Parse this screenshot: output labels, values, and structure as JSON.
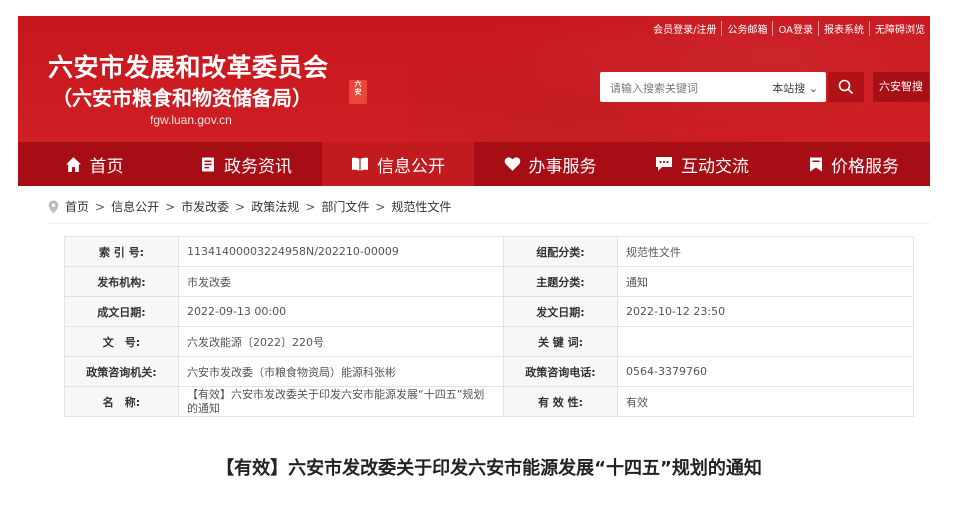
{
  "header": {
    "org_name": "六安市发展和改革委员会",
    "org_sub": "（六安市粮食和物资储备局）",
    "seal_text": "六安",
    "domain": "fgw.luan.gov.cn",
    "top_links": [
      "会员登录/注册",
      "公务邮箱",
      "OA登录",
      "报表系统",
      "无障碍浏览"
    ],
    "search": {
      "placeholder": "请输入搜索关键词",
      "scope": "本站搜 ⌄"
    },
    "smart_label": "六安智搜",
    "accent": "#c8161d",
    "nav_bg": "#a70d14"
  },
  "nav": [
    {
      "label": "首页",
      "icon": "home-icon"
    },
    {
      "label": "政务资讯",
      "icon": "document-icon"
    },
    {
      "label": "信息公开",
      "icon": "open-book-icon"
    },
    {
      "label": "办事服务",
      "icon": "heart-icon"
    },
    {
      "label": "互动交流",
      "icon": "chat-icon"
    },
    {
      "label": "价格服务",
      "icon": "bookmark-icon"
    }
  ],
  "breadcrumb": [
    "首页",
    "信息公开",
    "市发改委",
    "政策法规",
    "部门文件",
    "规范性文件"
  ],
  "meta": {
    "index_label": "索 引 号:",
    "index_value": "11341400003224958N/202210-00009",
    "category_label": "组配分类:",
    "category_value": "规范性文件",
    "publisher_label": "发布机构:",
    "publisher_value": "市发改委",
    "topic_label": "主题分类:",
    "topic_value": "通知",
    "created_label": "成文日期:",
    "created_value": "2022-09-13 00:00",
    "published_label": "发文日期:",
    "published_value": "2022-10-12 23:50",
    "docno_label": "文　号:",
    "docno_value": "六发改能源〔2022〕220号",
    "keywords_label": "关 键 词:",
    "keywords_value": "",
    "consult_label": "政策咨询机关:",
    "consult_value": "六安市发改委（市粮食物资局）能源科张彬",
    "phone_label": "政策咨询电话:",
    "phone_value": "0564-3379760",
    "name_label": "名　称:",
    "name_value": "【有效】六安市发改委关于印发六安市能源发展“十四五”规划的通知",
    "validity_label": "有 效 性:",
    "validity_value": "有效"
  },
  "document_title": "【有效】六安市发改委关于印发六安市能源发展“十四五”规划的通知"
}
